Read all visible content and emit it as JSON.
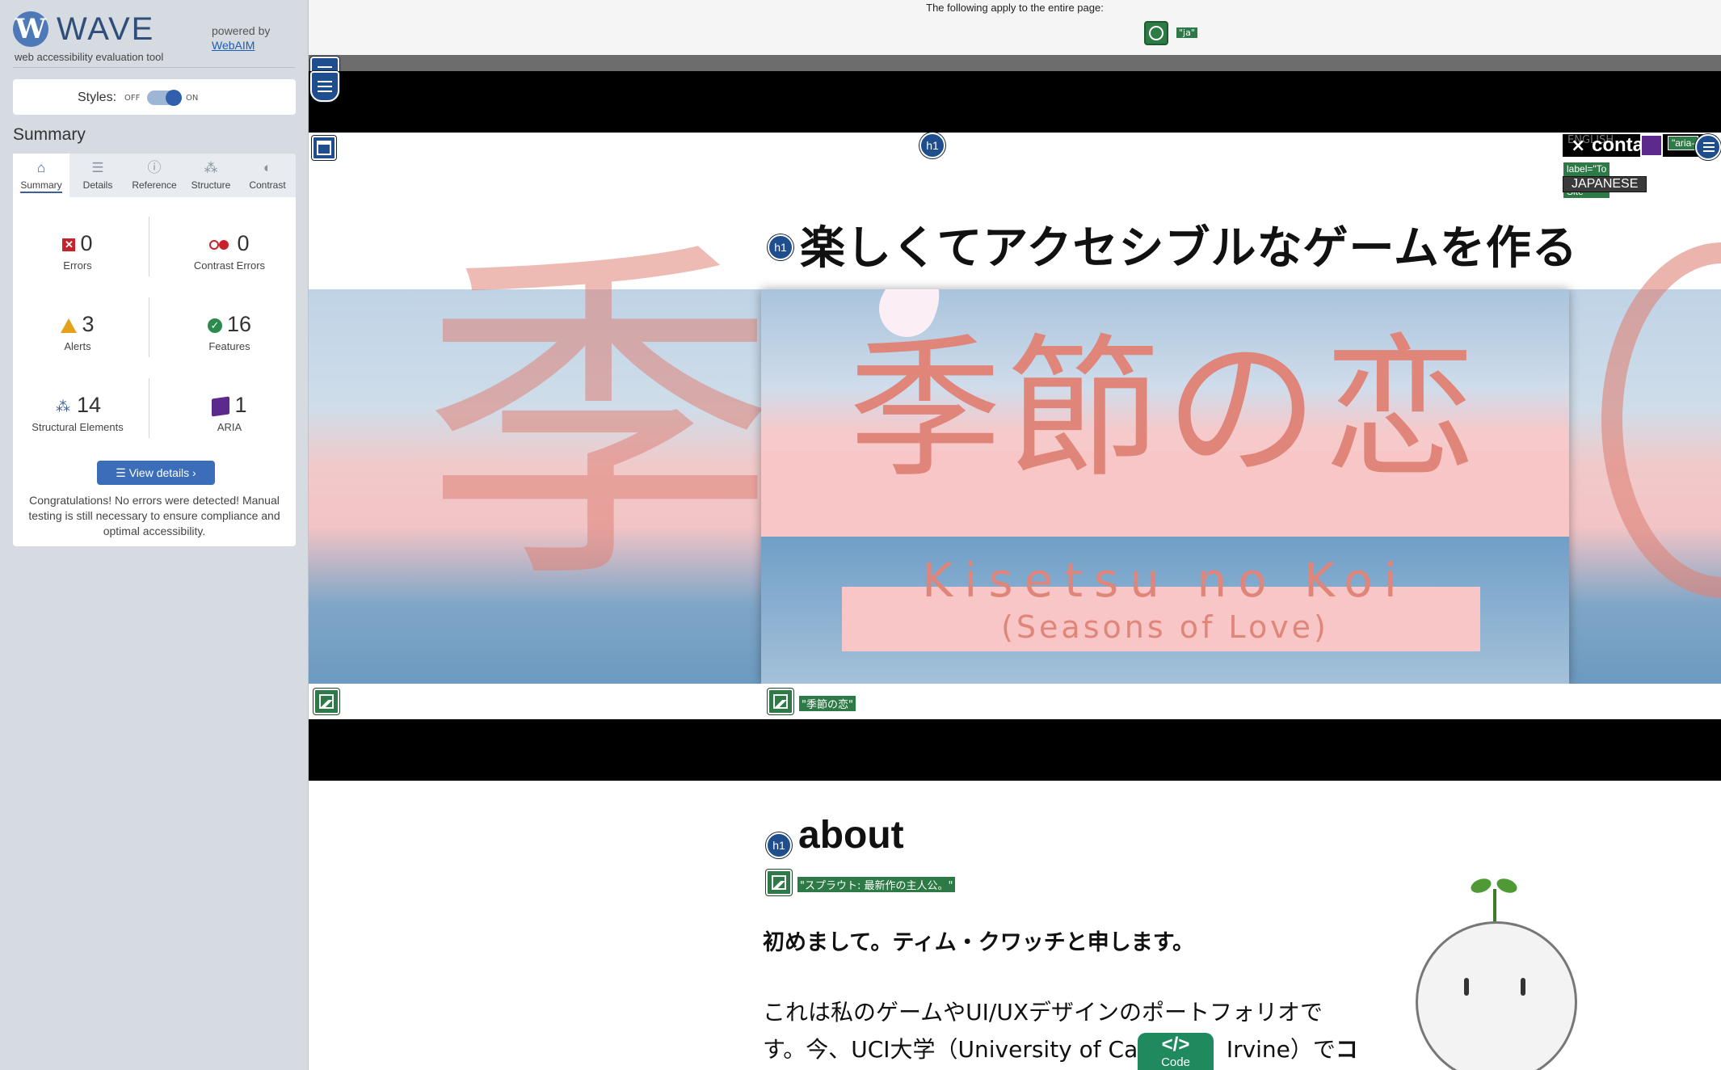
{
  "wave": {
    "logo_letter": "W",
    "title": "WAVE",
    "subtitle": "web accessibility evaluation tool",
    "powered_by": "powered by",
    "webaim": "WebAIM",
    "styles_label": "Styles:",
    "styles_off": "OFF",
    "styles_on": "ON",
    "summary_heading": "Summary",
    "tabs": [
      {
        "label": "Summary",
        "icon": "home-icon",
        "glyph": "⌂"
      },
      {
        "label": "Details",
        "icon": "list-icon",
        "glyph": "☰"
      },
      {
        "label": "Reference",
        "icon": "info-icon",
        "glyph": "ⓘ"
      },
      {
        "label": "Structure",
        "icon": "structure-icon",
        "glyph": "⁂"
      },
      {
        "label": "Contrast",
        "icon": "contrast-icon",
        "glyph": "◐"
      }
    ],
    "stats": {
      "errors": {
        "value": "0",
        "label": "Errors",
        "color": "#c8232b"
      },
      "contrast_errors": {
        "value": "0",
        "label": "Contrast Errors",
        "color": "#c8232b"
      },
      "alerts": {
        "value": "3",
        "label": "Alerts",
        "color": "#e3a21a"
      },
      "features": {
        "value": "16",
        "label": "Features",
        "color": "#2d8a4e"
      },
      "structural": {
        "value": "14",
        "label": "Structural Elements",
        "color": "#3b5f96"
      },
      "aria": {
        "value": "1",
        "label": "ARIA",
        "color": "#5b2a8c"
      }
    },
    "view_details": "View details ›",
    "congrats": "Congratulations! No errors were detected! Manual testing is still necessary to ensure compliance and optimal accessibility."
  },
  "page": {
    "doc_note": "The following apply to the entire page:",
    "lang_chip": "\"ja\"",
    "h1_badge": "h1",
    "nav_english": "ENGLISH",
    "nav_contact": "contact",
    "aria_label_chip": "\"aria-",
    "label_chip": "label=\"To English Site\"",
    "japanese_label": "JAPANESE",
    "hero_title": "楽しくてアクセシブルなゲームを作る",
    "banner_kanji": "季節の恋",
    "banner_romaji": "Kisetsu no Koi",
    "banner_english": "(Seasons of Love)",
    "banner_alt": "\"季節の恋\"",
    "about_title": "about",
    "sprout_alt": "\"スプラウト: 最新作の主人公。\"",
    "intro": "初めまして。ティム・クワッチと申します。",
    "para_line1": "これは私のゲームやUI/UXデザインのポートフォリオで",
    "para_line2_start": "す。今、UCI大学（University of Cali",
    "para_line2_mid": "Irvine）で",
    "para_line2_bold": "コン",
    "code_label": "Code",
    "code_glyph": "</>"
  }
}
